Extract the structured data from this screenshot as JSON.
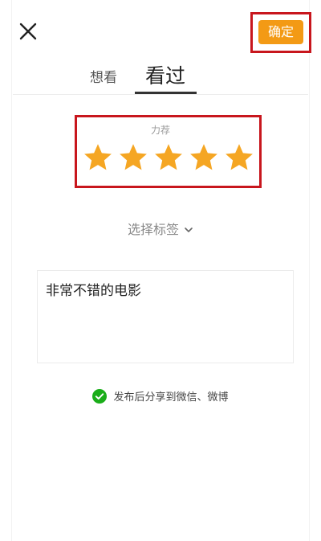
{
  "header": {
    "close_icon": "close-icon",
    "confirm_label": "确定",
    "highlight_color": "#c8161d",
    "accent_color": "#f39a15"
  },
  "tabs": [
    {
      "label": "想看",
      "active": false
    },
    {
      "label": "看过",
      "active": true
    }
  ],
  "rating": {
    "label": "力荐",
    "stars_filled": 5,
    "stars_total": 5,
    "star_color": "#f5a623"
  },
  "tags": {
    "label": "选择标签",
    "icon": "chevron-down-icon"
  },
  "comment": {
    "value": "非常不错的电影"
  },
  "share": {
    "checked": true,
    "check_color": "#1aad19",
    "label": "发布后分享到微信、微博"
  }
}
